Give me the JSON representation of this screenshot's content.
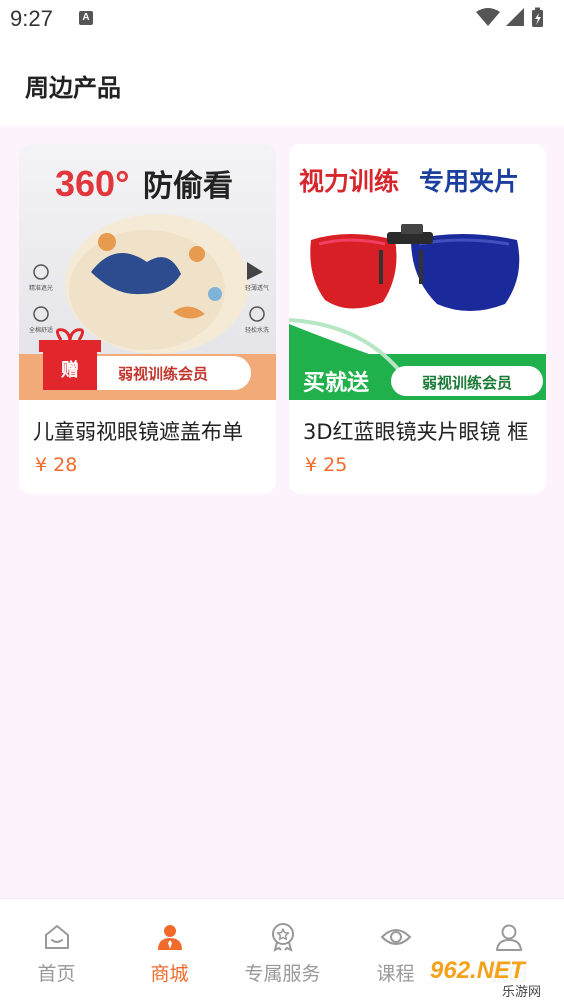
{
  "status": {
    "time": "9:27",
    "notif_glyph": "A"
  },
  "header": {
    "title": "周边产品"
  },
  "products": [
    {
      "name": "儿童弱视眼镜遮盖布单",
      "price": "¥ 28",
      "image_text": {
        "headline": "360°",
        "headline_suffix": "防偷看",
        "badge": "赠",
        "ribbon": "弱视训练会员",
        "feature_labels": [
          "精准遮光",
          "轻薄透气",
          "全棉舒适",
          "轻松水洗"
        ]
      }
    },
    {
      "name": "3D红蓝眼镜夹片眼镜 框",
      "price": "¥ 25",
      "image_text": {
        "headline_a": "视力训练",
        "headline_b": "专用夹片",
        "promo": "买就送",
        "ribbon": "弱视训练会员"
      }
    }
  ],
  "tabbar": {
    "items": [
      {
        "label": "首页",
        "icon": "home-icon",
        "active": false
      },
      {
        "label": "商城",
        "icon": "shop-user-icon",
        "active": true
      },
      {
        "label": "专属服务",
        "icon": "badge-icon",
        "active": false
      },
      {
        "label": "课程",
        "icon": "eye-icon",
        "active": false
      },
      {
        "label": "我的",
        "icon": "profile-icon",
        "active": false
      }
    ]
  },
  "watermark": {
    "main": "962.NET",
    "sub": "乐游网"
  },
  "colors": {
    "accent": "#f26a2c",
    "background": "#fcf3fd",
    "tab_inactive": "#999999"
  }
}
